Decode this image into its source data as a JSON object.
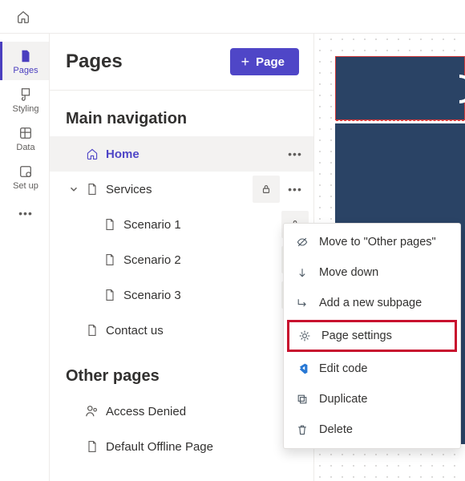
{
  "rail": {
    "items": [
      {
        "label": "Pages",
        "icon": "page-solid-icon",
        "active": true
      },
      {
        "label": "Styling",
        "icon": "brush-icon"
      },
      {
        "label": "Data",
        "icon": "grid-icon"
      },
      {
        "label": "Set up",
        "icon": "gear-grid-icon"
      }
    ]
  },
  "panel": {
    "title": "Pages",
    "add_label": "Page",
    "sections": {
      "main_nav": "Main navigation",
      "other": "Other pages"
    }
  },
  "tree": {
    "home": "Home",
    "services": "Services",
    "scenario1": "Scenario 1",
    "scenario2": "Scenario 2",
    "scenario3": "Scenario 3",
    "contact": "Contact us",
    "access": "Access Denied",
    "offline": "Default Offline Page"
  },
  "menu": {
    "move_other": "Move to \"Other pages\"",
    "move_down": "Move down",
    "add_sub": "Add a new subpage",
    "settings": "Page settings",
    "edit_code": "Edit code",
    "duplicate": "Duplicate",
    "delete": "Delete"
  }
}
